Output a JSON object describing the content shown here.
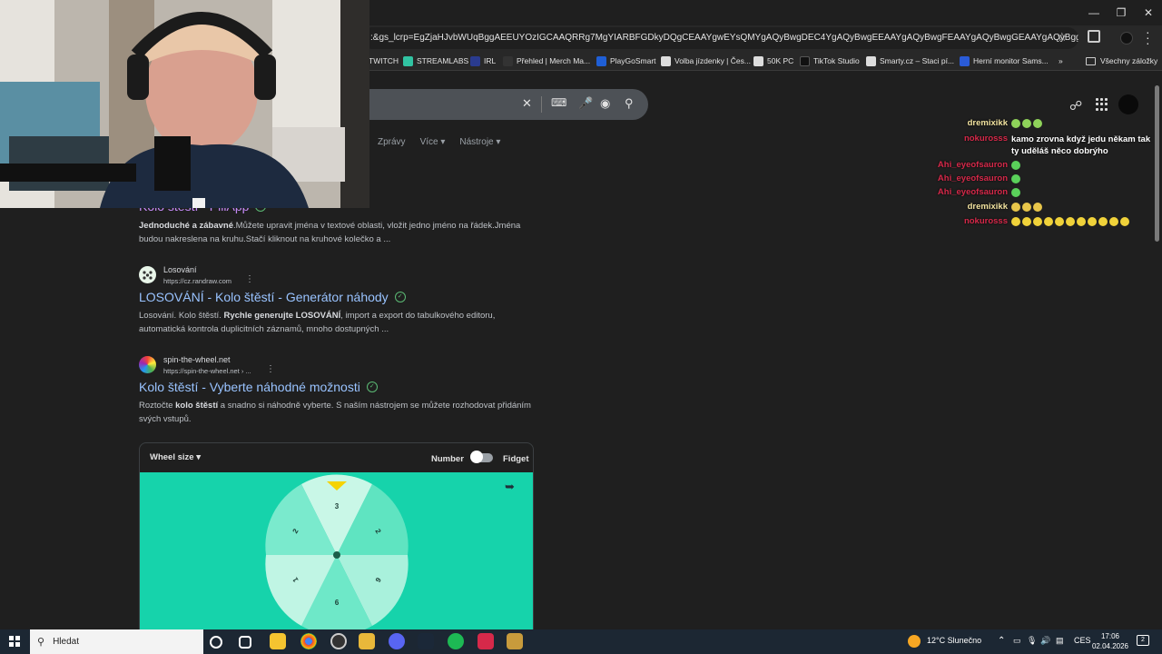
{
  "browser": {
    "url": ":&gs_lcrp=EgZjaHJvbWUqBggAEEUYOzIGCAAQRRg7MgYIARBFGDkyDQgCEAAYgwEYsQMYgAQyBwgDEC4YgAQyBwgEEAAYgAQyBwgFEAAYgAQyBwgGEAAYgAQyBggHEEUYPdIBCDE...",
    "bookmarks": [
      {
        "label": "TWITCH",
        "color": "#9146ff"
      },
      {
        "label": "STREAMLABS",
        "color": "#31c3a2"
      },
      {
        "label": "IRL",
        "color": "#2a3b8f"
      },
      {
        "label": "Přehled | Merch Ma...",
        "color": "#333333"
      },
      {
        "label": "PlayGoSmart",
        "color": "#1f5fd6"
      },
      {
        "label": "Volba jízdenky | Čes...",
        "color": "#dddddd"
      },
      {
        "label": "50K PC",
        "color": "#dddddd"
      },
      {
        "label": "TikTok Studio",
        "color": "#111111"
      },
      {
        "label": "Smarty.cz – Staci pí...",
        "color": "#dddddd"
      },
      {
        "label": "Herní monitor Sams...",
        "color": "#2a5bd7"
      }
    ],
    "more_bookmarks": "»",
    "all_bookmarks": "Všechny záložky"
  },
  "google": {
    "tabs": [
      "Zprávy",
      "Více ▾",
      "Nástroje ▾"
    ],
    "results": [
      {
        "title": "Kolo štěstí - PiliApp",
        "snippet_bold": "Jednoduché a zábavné",
        "snippet": ".Můžete upravit jména v textové oblasti, vložit jedno jméno na řádek.Jména budou nakreslena na kruhu.Stačí kliknout na kruhové kolečko a ..."
      },
      {
        "site": "Losování",
        "url": "https://cz.randraw.com",
        "title": "LOSOVÁNÍ - Kolo štěstí - Generátor náhody",
        "snippet_a": "Losování. Kolo štěstí. ",
        "snippet_bold": "Rychle generujte LOSOVÁNÍ",
        "snippet_b": ", import a export do tabulkového editoru, automatická kontrola duplicitních záznamů, mnoho dostupných ..."
      },
      {
        "site": "spin-the-wheel.net",
        "url": "https://spin-the-wheel.net › ...",
        "title": "Kolo štěstí - Vyberte náhodné možnosti",
        "snippet_a": "Roztočte ",
        "snippet_bold": "kolo štěstí",
        "snippet_b": " a snadno si náhodně vyberte. S naším nástrojem se můžete rozhodovat přidáním svých vstupů."
      }
    ],
    "wheel": {
      "size_label": "Wheel size",
      "number_label": "Number",
      "fidget_label": "Fidget",
      "numbers": [
        "3",
        "2",
        "2",
        "1",
        "9",
        "6"
      ]
    }
  },
  "chat": [
    {
      "user": "dremixikk",
      "user_color": "#f2e3a0",
      "msg": "",
      "emotes": 3
    },
    {
      "user": "nokurosss",
      "user_color": "#d6294a",
      "msg": "kamo zrovna když jedu někam tak ty uděláš něco dobrýho",
      "emotes": 0
    },
    {
      "user": "Ahi_eyeofsauron",
      "user_color": "#d6294a",
      "msg": "",
      "emotes": 1
    },
    {
      "user": "Ahi_eyeofsauron",
      "user_color": "#d6294a",
      "msg": "",
      "emotes": 1
    },
    {
      "user": "Ahi_eyeofsauron",
      "user_color": "#d6294a",
      "msg": "",
      "emotes": 1
    },
    {
      "user": "dremixikk",
      "user_color": "#f2e3a0",
      "msg": "",
      "emotes": 3
    },
    {
      "user": "nokurosss",
      "user_color": "#d6294a",
      "msg": "",
      "emotes": 11
    }
  ],
  "taskbar": {
    "search_placeholder": "Hledat",
    "weather": "12°C  Slunečno",
    "lang": "CES",
    "time": "17:06",
    "date": "02.04.2026",
    "notif_count": "2"
  }
}
